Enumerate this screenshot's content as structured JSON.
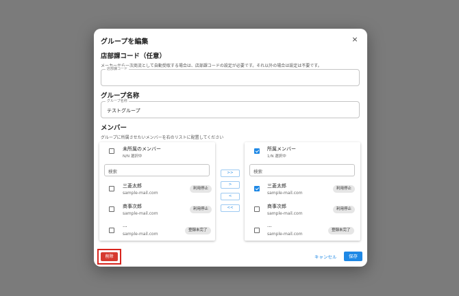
{
  "dialog": {
    "title": "グループを編集",
    "close_icon": "×"
  },
  "store_code": {
    "title": "店部課コード（任意）",
    "description": "メーカーから一次商流として自動受取する場合は、店部課コードの設定が必要です。それ以外の場合は設定は不要です。",
    "field_label": "店部課コード",
    "value": ""
  },
  "group_name": {
    "title": "グループ名称",
    "field_label": "グループ名称",
    "value": "テストグループ"
  },
  "members": {
    "title": "メンバー",
    "description": "グループに所属させたいメンバーを右のリストに配置してください"
  },
  "left_panel": {
    "header": "未所属のメンバー",
    "sub": "N/N 選択中",
    "search_placeholder": "検索",
    "rows": [
      {
        "name": "三菱太郎",
        "email": "sample-mail.com",
        "badge": "利用停止",
        "checked": false
      },
      {
        "name": "商事次郎",
        "email": "sample-mail.com",
        "badge": "利用停止",
        "checked": false
      },
      {
        "name": "...",
        "email": "sample-mail.com",
        "badge": "登録未完了",
        "checked": false
      }
    ]
  },
  "right_panel": {
    "header": "所属メンバー",
    "sub": "1/N 選択中",
    "search_placeholder": "検索",
    "rows": [
      {
        "name": "三菱太郎",
        "email": "sample-mail.com",
        "badge": "利用停止",
        "checked": true
      },
      {
        "name": "商事次郎",
        "email": "sample-mail.com",
        "badge": "利用停止",
        "checked": false
      },
      {
        "name": "...",
        "email": "sample-mail.com",
        "badge": "登録未完了",
        "checked": false
      }
    ]
  },
  "transfer": {
    "all_right": ">>",
    "right": ">",
    "left": "<",
    "all_left": "<<"
  },
  "footer": {
    "delete": "削除",
    "cancel": "キャンセル",
    "save": "保存"
  },
  "colors": {
    "primary": "#1e88e5",
    "danger": "#d63a2f",
    "overlay": "#7b7b7b"
  }
}
